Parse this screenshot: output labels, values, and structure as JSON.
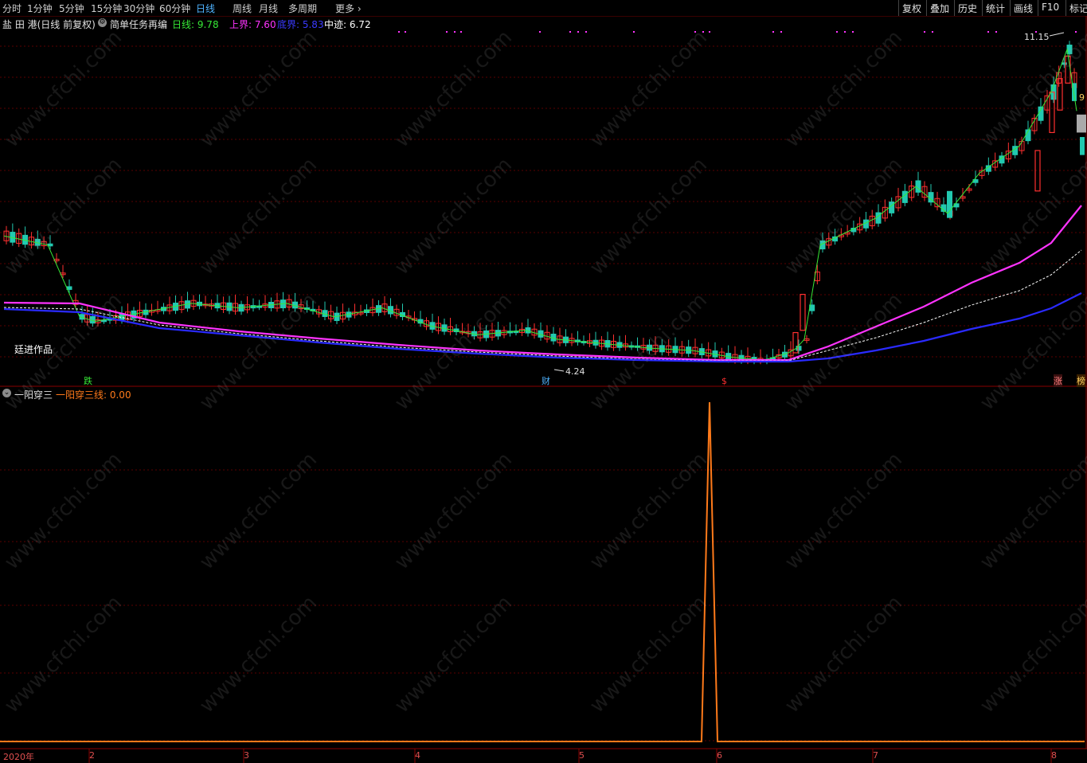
{
  "toolbar": {
    "periods": [
      "分时",
      "1分钟",
      "5分钟",
      "15分钟",
      "30分钟",
      "60分钟",
      "日线",
      "周线",
      "月线",
      "多周期",
      "更多"
    ],
    "active": "日线",
    "more_arrow": "›",
    "right_buttons": [
      "复权",
      "叠加",
      "历史",
      "统计",
      "画线",
      "F10",
      "标记"
    ]
  },
  "info": {
    "stock": "盐 田 港(日线 前复权)",
    "indicator_name": "简单任务再编",
    "day_label": "日线: 9.78",
    "upper_label": "上界: 7.60",
    "lower_label": "底界: 5.83",
    "mid_label": "中迹: 6.72"
  },
  "colors": {
    "day": "#36e836",
    "upper": "#ff33ff",
    "lower": "#2a2aff",
    "mid": "#ffffff",
    "up_candle": "#ff3030",
    "down_candle": "#22c9b0",
    "signal": "#ff7a1a",
    "grid": "#5a0000"
  },
  "annotations": {
    "author": "廷进作品",
    "high": "11.15",
    "low": "4.24",
    "tag_die": "跌",
    "tag_cai": "财",
    "tag_dollar": "$",
    "tag_zhang": "涨",
    "tag_bang": "榜",
    "right_value": "9"
  },
  "sub_panel": {
    "name": "一阳穿三",
    "line_label": "一阳穿三线: 0.00"
  },
  "watermark": "www.cfchi.com",
  "dates": [
    "2020年",
    "2",
    "3",
    "4",
    "5",
    "6",
    "7",
    "8"
  ],
  "chart_data": {
    "type": "line",
    "title": "盐 田 港(日线 前复权)",
    "main_series": [
      {
        "name": "日线",
        "close_path": [
          7.0,
          6.8,
          5.2,
          5.1,
          5.3,
          5.5,
          5.4,
          5.5,
          5.2,
          5.4,
          5.0,
          4.8,
          4.9,
          4.7,
          4.6,
          4.5,
          4.45,
          4.3,
          4.24,
          4.4,
          4.5,
          4.7,
          6.8,
          7.4,
          8.1,
          7.5,
          8.4,
          9.0,
          10.2,
          11.15,
          9.78
        ]
      },
      {
        "name": "上界",
        "value": 7.6
      },
      {
        "name": "底界",
        "value": 5.83
      },
      {
        "name": "中迹",
        "value": 6.72
      }
    ],
    "sub_series": {
      "name": "一阳穿三线",
      "current_value": 0.0,
      "events": [
        {
          "month": "6",
          "value": 1
        }
      ]
    },
    "high": 11.15,
    "low": 4.24
  }
}
